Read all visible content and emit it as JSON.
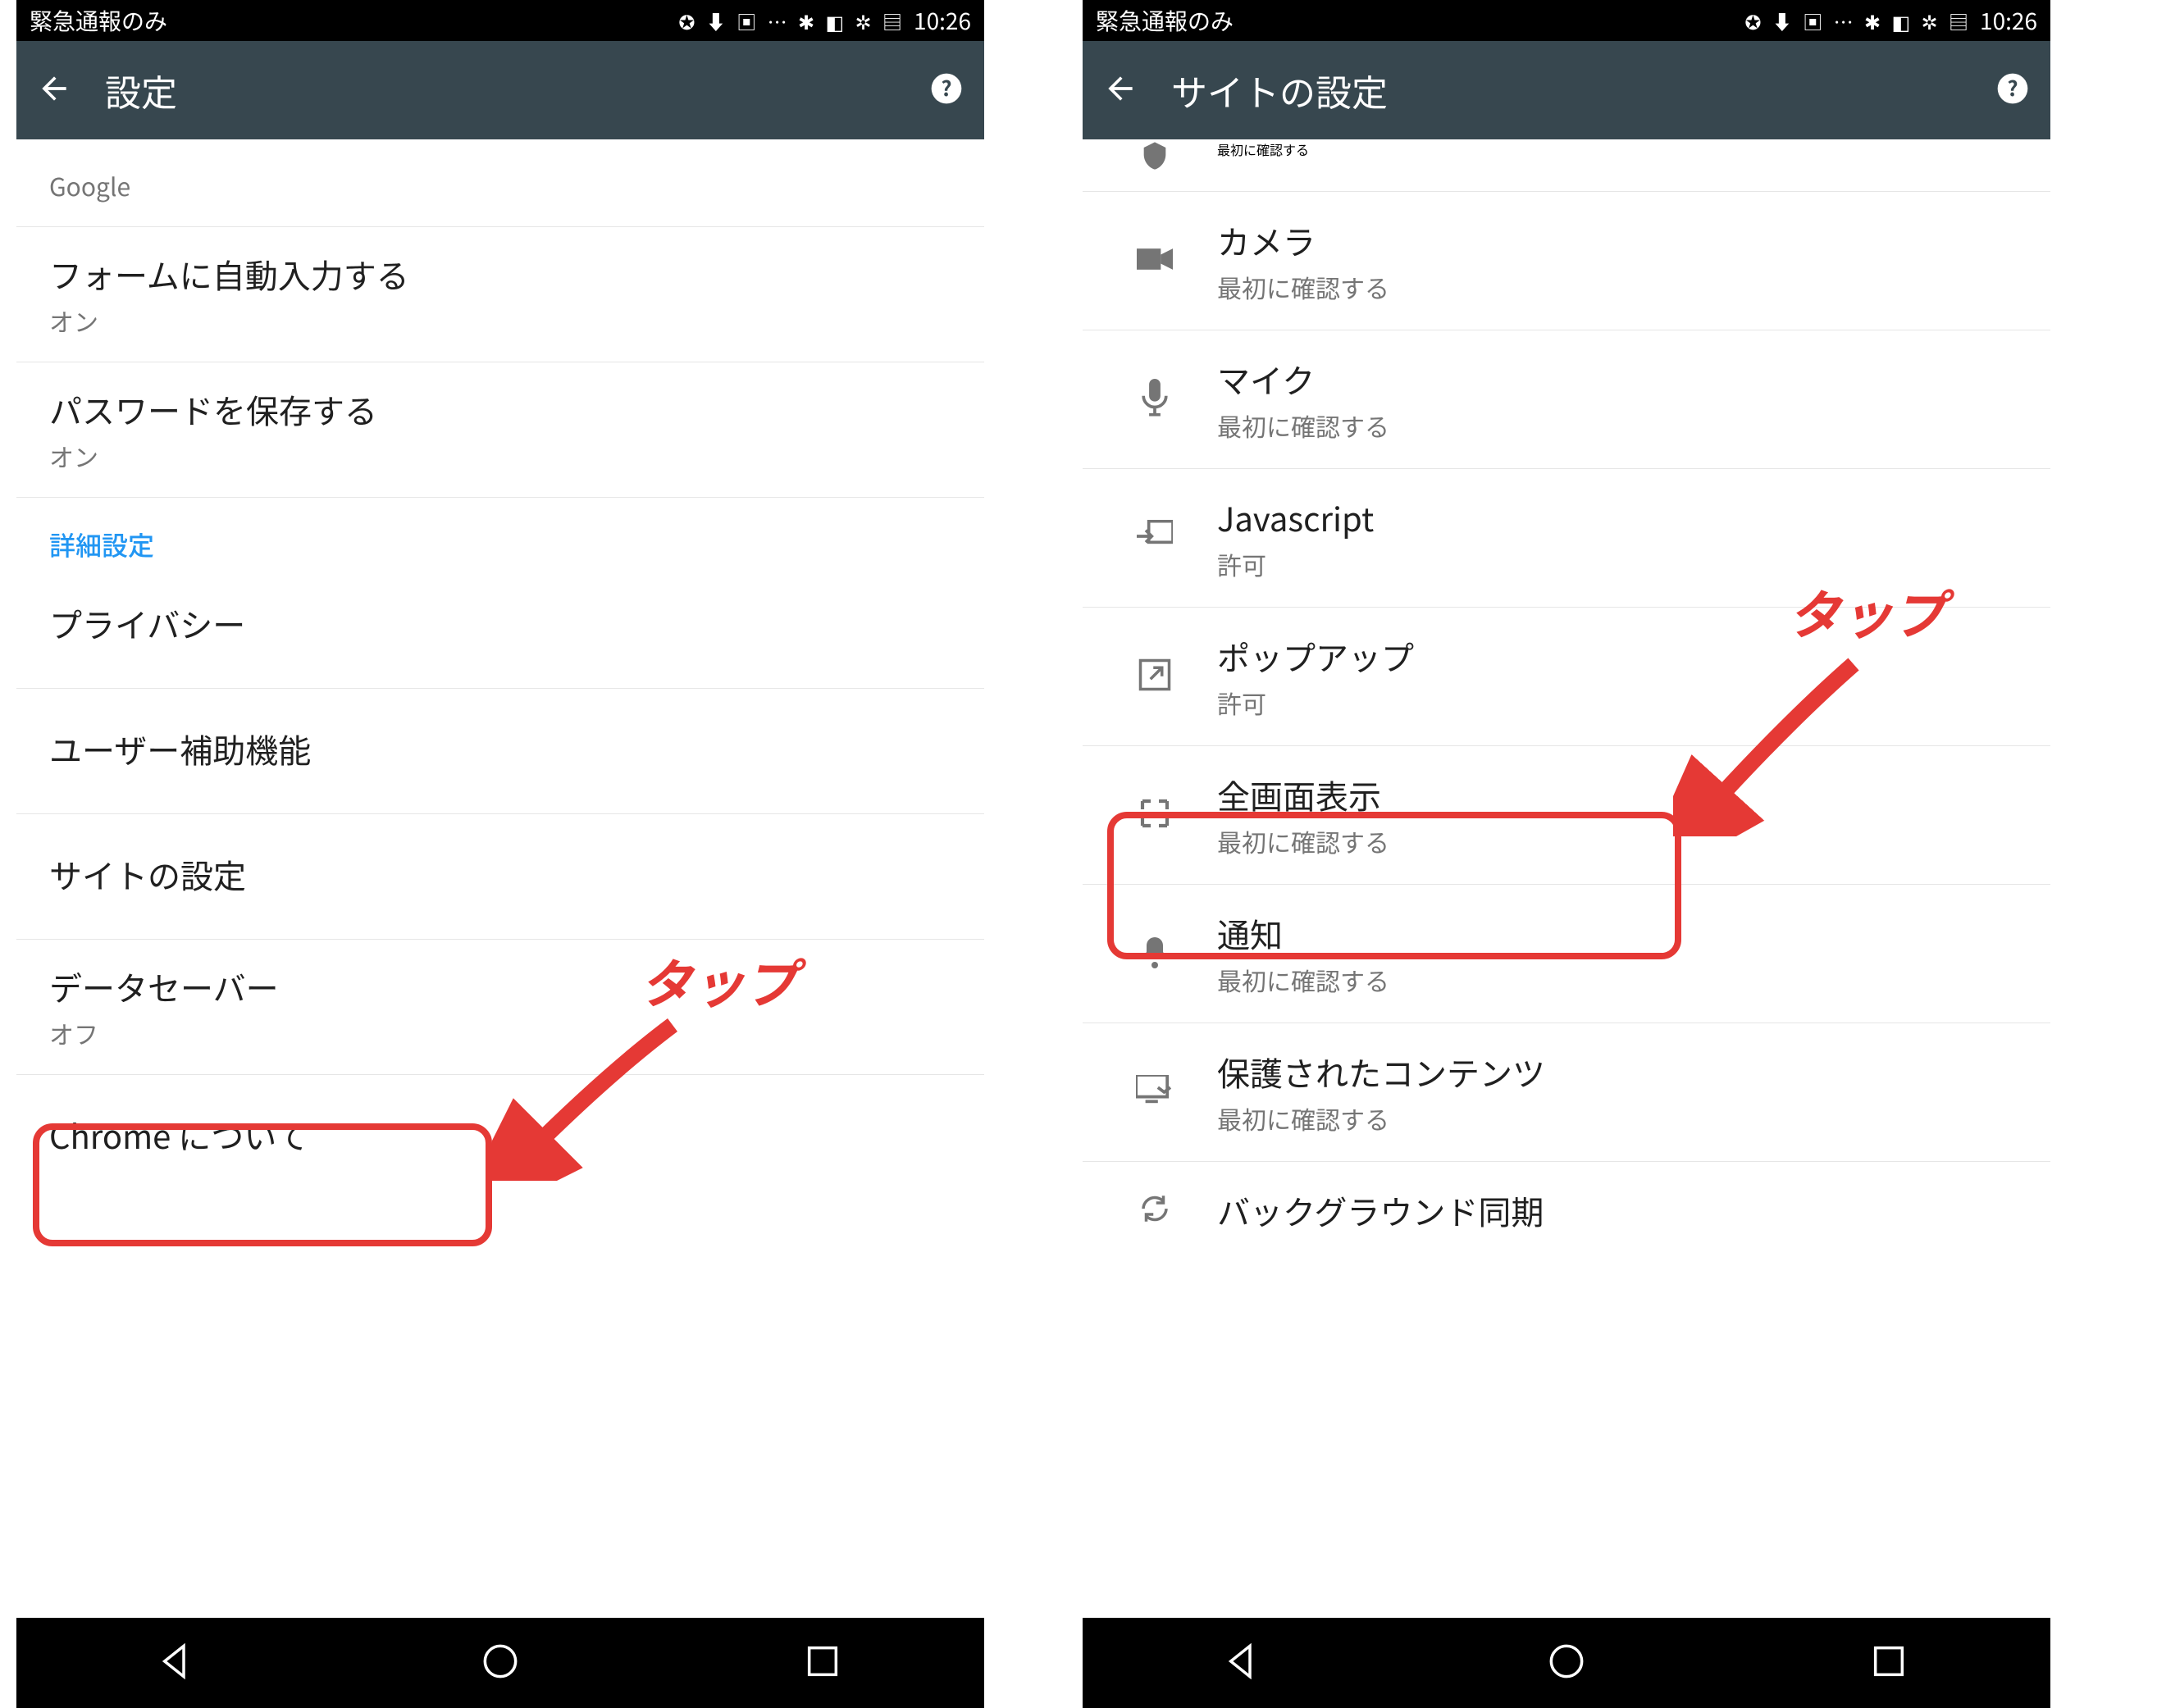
{
  "statusbar": {
    "carrier": "緊急通報のみ",
    "time": "10:26"
  },
  "left_screen": {
    "header_title": "設定",
    "items": {
      "google_sub": "Google",
      "autofill_title": "フォームに自動入力する",
      "autofill_sub": "オン",
      "password_title": "パスワードを保存する",
      "password_sub": "オン",
      "section": "詳細設定",
      "privacy_title": "プライバシー",
      "accessibility_title": "ユーザー補助機能",
      "site_settings_title": "サイトの設定",
      "datasaver_title": "データセーバー",
      "datasaver_sub": "オフ",
      "about_title": "Chrome について"
    },
    "annotation": "タップ"
  },
  "right_screen": {
    "header_title": "サイトの設定",
    "items": {
      "top_sub": "最初に確認する",
      "camera_title": "カメラ",
      "camera_sub": "最初に確認する",
      "mic_title": "マイク",
      "mic_sub": "最初に確認する",
      "js_title": "Javascript",
      "js_sub": "許可",
      "popup_title": "ポップアップ",
      "popup_sub": "許可",
      "fullscreen_title": "全画面表示",
      "fullscreen_sub": "最初に確認する",
      "notify_title": "通知",
      "notify_sub": "最初に確認する",
      "protected_title": "保護されたコンテンツ",
      "protected_sub": "最初に確認する",
      "bgsync_title": "バックグラウンド同期"
    },
    "annotation": "タップ"
  }
}
